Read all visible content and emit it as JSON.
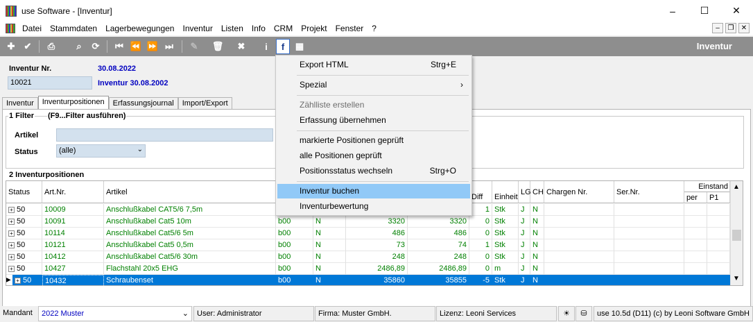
{
  "window": {
    "title": "use Software - [Inventur]",
    "min": "–",
    "max": "☐",
    "close": "✕"
  },
  "menu": [
    "Datei",
    "Stammdaten",
    "Lagerbewegungen",
    "Inventur",
    "Listen",
    "Info",
    "CRM",
    "Projekt",
    "Fenster",
    "?"
  ],
  "mdi": {
    "min": "–",
    "restore": "❐",
    "close": "✕"
  },
  "toolbar": {
    "title": "Inventur",
    "icons": [
      "add-icon",
      "check-icon",
      "print-icon",
      "search-icon",
      "refresh-icon",
      "first-record-icon",
      "prev-record-icon",
      "next-record-icon",
      "last-record-icon",
      "edit-icon",
      "delete-icon",
      "cancel-icon",
      "info-icon",
      "functions-icon",
      "grid-menu-icon"
    ]
  },
  "header": {
    "inv_nr_label": "Inventur Nr.",
    "date": "30.08.2022",
    "inv_nr_value": "10021",
    "inv_title": "Inventur 30.08.2002"
  },
  "tabs": [
    "Inventur",
    "Inventurpositionen",
    "Erfassungsjournal",
    "Import/Export"
  ],
  "filter": {
    "section": "1 Filter",
    "hint": "(F9...Filter ausführen)",
    "artikel_label": "Artikel",
    "artikel_value": "",
    "status_label": "Status",
    "status_value": "(alle)"
  },
  "positions": {
    "section": "2 Inventurpositionen",
    "columns": {
      "status": "Status",
      "artnr": "Art.Nr.",
      "artikel": "Artikel",
      "diff": "Diff",
      "einheit": "Einheit",
      "lg": "LG",
      "ch": "CH",
      "chargen": "Chargen Nr.",
      "sernr": "Ser.Nr.",
      "einstand": "Einstand",
      "per": "per",
      "p1": "P1"
    },
    "rows": [
      {
        "status": "50",
        "artnr": "10009",
        "artikel": "Anschlußkabel CAT5/6 7,5m",
        "lager": "",
        "n": "",
        "soll": "",
        "ist": "",
        "diff": "1",
        "einheit": "Stk",
        "lg": "J",
        "ch": "N"
      },
      {
        "status": "50",
        "artnr": "10091",
        "artikel": "Anschlußkabel Cat5 10m",
        "lager": "b00",
        "n": "N",
        "soll": "3320",
        "ist": "3320",
        "diff": "0",
        "einheit": "Stk",
        "lg": "J",
        "ch": "N"
      },
      {
        "status": "50",
        "artnr": "10114",
        "artikel": "Anschlußkabel Cat5/6 5m",
        "lager": "b00",
        "n": "N",
        "soll": "486",
        "ist": "486",
        "diff": "0",
        "einheit": "Stk",
        "lg": "J",
        "ch": "N"
      },
      {
        "status": "50",
        "artnr": "10121",
        "artikel": "Anschlußkabel Cat5 0,5m",
        "lager": "b00",
        "n": "N",
        "soll": "73",
        "ist": "74",
        "diff": "1",
        "einheit": "Stk",
        "lg": "J",
        "ch": "N"
      },
      {
        "status": "50",
        "artnr": "10412",
        "artikel": "Anschlußkabel Cat5/6 30m",
        "lager": "b00",
        "n": "N",
        "soll": "248",
        "ist": "248",
        "diff": "0",
        "einheit": "Stk",
        "lg": "J",
        "ch": "N"
      },
      {
        "status": "50",
        "artnr": "10427",
        "artikel": "Flachstahl 20x5 EHG",
        "lager": "b00",
        "n": "N",
        "soll": "2486,89",
        "ist": "2486,89",
        "diff": "0",
        "einheit": "m",
        "lg": "J",
        "ch": "N"
      },
      {
        "status": "50",
        "artnr": "10432",
        "artikel": "Schraubenset",
        "lager": "b00",
        "n": "N",
        "soll": "35860",
        "ist": "35855",
        "diff": "-5",
        "einheit": "Stk",
        "lg": "J",
        "ch": "N"
      }
    ]
  },
  "statusbar": {
    "mandant_label": "Mandant",
    "mandant_value": "2022 Muster",
    "user": "User: Administrator",
    "firma": "Firma: Muster GmbH.",
    "lizenz": "Lizenz: Leoni Services",
    "version": "use 10.5d (D11) (c) by Leoni Software GmbH"
  },
  "dropdown": {
    "items": [
      {
        "label": "Export HTML",
        "shortcut": "Strg+E"
      },
      {
        "label": "Spezial",
        "shortcut": "›"
      },
      {
        "label": "Zählliste erstellen",
        "shortcut": ""
      },
      {
        "label": "Erfassung übernehmen",
        "shortcut": ""
      },
      {
        "label": "markierte Positionen geprüft",
        "shortcut": ""
      },
      {
        "label": "alle Positionen geprüft",
        "shortcut": ""
      },
      {
        "label": "Positionsstatus wechseln",
        "shortcut": "Strg+O"
      },
      {
        "label": "Inventur buchen",
        "shortcut": ""
      },
      {
        "label": "Inventurbewertung",
        "shortcut": ""
      }
    ]
  },
  "colors": {
    "accent": "#0078d7",
    "toolbar": "#8e8e8e",
    "highlight": "#91c9f7",
    "green_text": "#008000",
    "blue_text": "#0000c0"
  }
}
